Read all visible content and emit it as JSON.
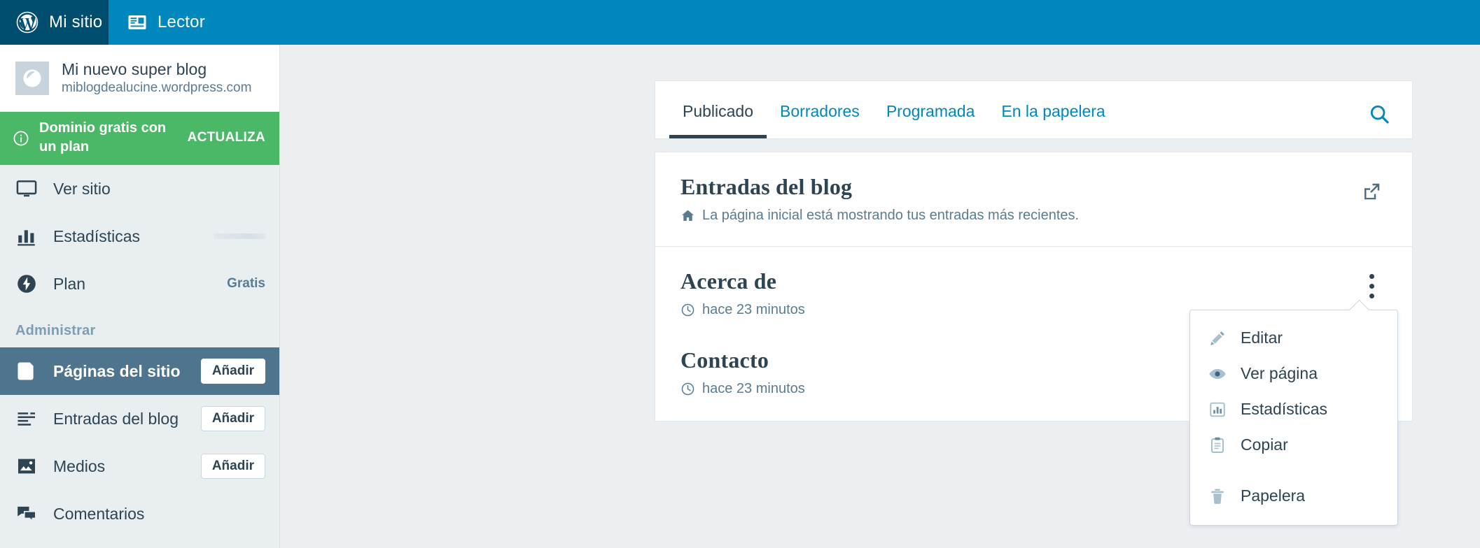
{
  "theme": {
    "masterbar_bg": "#0087be",
    "masterbar_active_bg": "#004e6f",
    "sidebar_bg": "#e9eef1",
    "accent_blue": "#0087be",
    "text_dark": "#2e4453",
    "text_muted": "#5a7b90",
    "upgrade_green": "#4ab866",
    "selected_nav_bg": "#4f748e",
    "content_bg": "#eceff2"
  },
  "masterbar": {
    "items": [
      {
        "label": "Mi sitio",
        "icon": "wordpress-logo-icon",
        "active": true
      },
      {
        "label": "Lector",
        "icon": "reader-icon",
        "active": false
      }
    ]
  },
  "sidebar": {
    "site": {
      "title": "Mi nuevo super blog",
      "url": "miblogdealucine.wordpress.com",
      "thumb_icon": "globe-icon"
    },
    "upgrade": {
      "icon": "info-circle-icon",
      "text": "Dominio gratis con un plan",
      "cta_label": "ACTUALIZA"
    },
    "nav_top": [
      {
        "label": "Ver sitio",
        "icon": "monitor-icon",
        "badge": "",
        "kind": "plain"
      },
      {
        "label": "Estadísticas",
        "icon": "bar-chart-icon",
        "badge": "",
        "kind": "sparkline"
      },
      {
        "label": "Plan",
        "icon": "plan-bolt-icon",
        "badge": "Gratis",
        "kind": "badge"
      }
    ],
    "section_title": "Administrar",
    "nav_manage": [
      {
        "label": "Páginas del sitio",
        "icon": "page-icon",
        "action_label": "Añadir",
        "selected": true
      },
      {
        "label": "Entradas del blog",
        "icon": "posts-icon",
        "action_label": "Añadir",
        "selected": false
      },
      {
        "label": "Medios",
        "icon": "media-image-icon",
        "action_label": "Añadir",
        "selected": false
      },
      {
        "label": "Comentarios",
        "icon": "comments-icon",
        "action_label": "",
        "selected": false
      }
    ]
  },
  "main": {
    "tabs": [
      {
        "label": "Publicado",
        "active": true
      },
      {
        "label": "Borradores",
        "active": false
      },
      {
        "label": "Programada",
        "active": false
      },
      {
        "label": "En la papelera",
        "active": false
      }
    ],
    "search_icon": "search-icon",
    "pages": [
      {
        "title": "Entradas del blog",
        "meta_icon": "home-icon",
        "meta_text": "La página inicial está mostrando tus entradas más recientes.",
        "action_icon": "external-link-icon"
      },
      {
        "title": "Acerca de",
        "meta_icon": "clock-icon",
        "meta_text": "hace 23 minutos",
        "action_icon": "ellipsis-vertical-icon"
      },
      {
        "title": "Contacto",
        "meta_icon": "clock-icon",
        "meta_text": "hace 23 minutos",
        "action_icon": "ellipsis-vertical-icon"
      }
    ]
  },
  "popover": {
    "items": [
      {
        "label": "Editar",
        "icon": "pencil-icon"
      },
      {
        "label": "Ver página",
        "icon": "eye-icon"
      },
      {
        "label": "Estadísticas",
        "icon": "bar-chart-icon"
      },
      {
        "label": "Copiar",
        "icon": "clipboard-icon"
      },
      {
        "label": "Papelera",
        "icon": "trash-icon"
      }
    ]
  }
}
